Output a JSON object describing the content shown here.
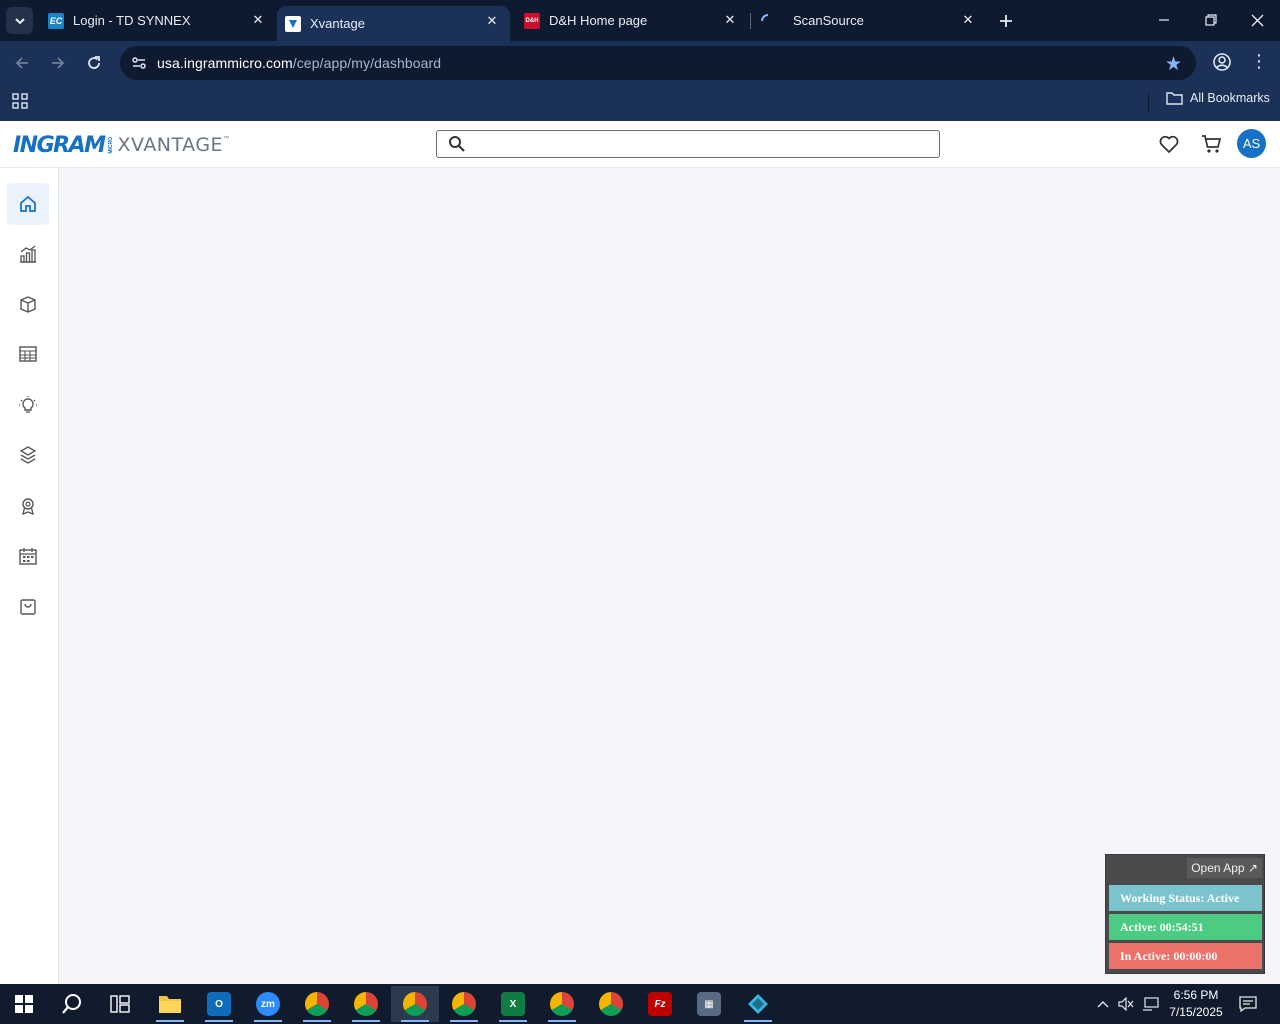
{
  "browser": {
    "tabs": [
      {
        "title": "Login - TD SYNNEX",
        "favicon": "EC"
      },
      {
        "title": "Xvantage",
        "favicon": "xvantage-logo"
      },
      {
        "title": "D&H Home page",
        "favicon": "D&H"
      },
      {
        "title": "ScanSource",
        "favicon": "loading-spinner"
      }
    ],
    "active_tab_index": 1,
    "url_host": "usa.ingrammicro.com",
    "url_path": "/cep/app/my/dashboard",
    "bookmarks_label": "All Bookmarks"
  },
  "site": {
    "logo_primary": "INGRAM",
    "logo_micro": "MICRO",
    "logo_product": "XVANTAGE",
    "logo_tm": "™",
    "search_placeholder": "",
    "avatar_initials": "AS",
    "accent_color": "#1570c6"
  },
  "sidebar": {
    "items": [
      {
        "icon": "home-icon",
        "active": true
      },
      {
        "icon": "analytics-icon",
        "active": false
      },
      {
        "icon": "box-icon",
        "active": false
      },
      {
        "icon": "grid-table-icon",
        "active": false
      },
      {
        "icon": "lightbulb-icon",
        "active": false
      },
      {
        "icon": "stack-icon",
        "active": false
      },
      {
        "icon": "award-icon",
        "active": false
      },
      {
        "icon": "calendar-icon",
        "active": false
      },
      {
        "icon": "shopping-bag-icon",
        "active": false
      }
    ]
  },
  "widget": {
    "open_app": "Open App ↗",
    "working_status": "Working Status: Active",
    "active_time": "Active: 00:54:51",
    "inactive_time": "In Active: 00:00:00"
  },
  "taskbar": {
    "apps": [
      "start",
      "search",
      "task-view",
      "file-explorer",
      "outlook",
      "zoom",
      "chrome-w",
      "chrome-o",
      "chrome-active",
      "chrome-g",
      "excel",
      "chrome-r",
      "chrome-p",
      "filezilla",
      "calculator",
      "vpn"
    ],
    "time": "6:56 PM",
    "date": "7/15/2025"
  }
}
